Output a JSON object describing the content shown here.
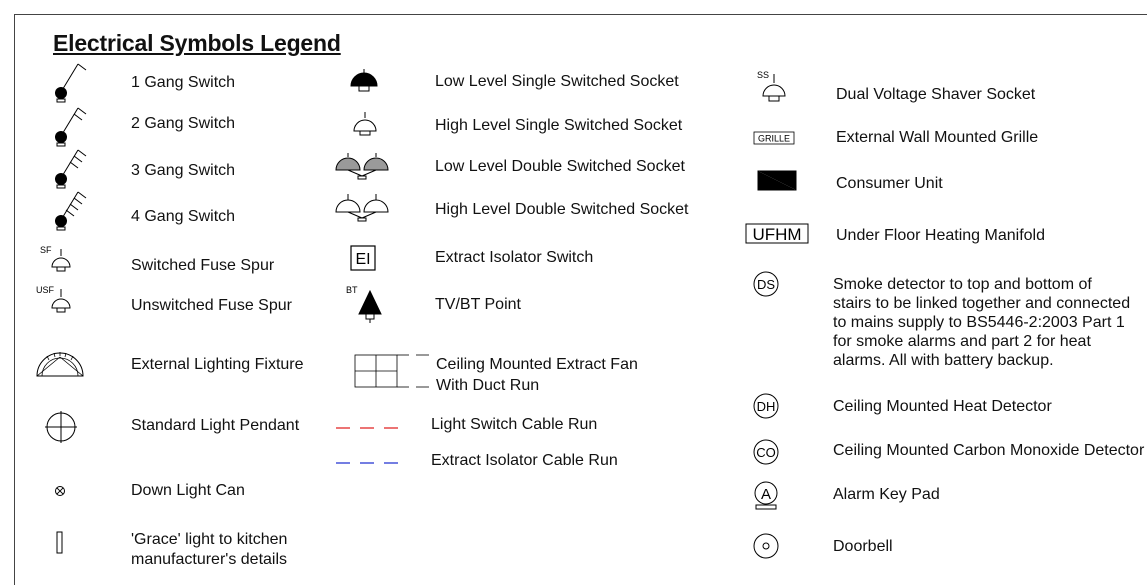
{
  "title": "Electrical Symbols Legend",
  "col1": {
    "one_gang": "1 Gang Switch",
    "two_gang": "2 Gang Switch",
    "three_gang": "3 Gang Switch",
    "four_gang": "4 Gang Switch",
    "switched_fuse": "Switched Fuse Spur",
    "unswitched_fuse": "Unswitched Fuse Spur",
    "ext_lighting": "External Lighting Fixture",
    "std_pendant": "Standard Light Pendant",
    "down_light": "Down Light Can",
    "grace": "'Grace' light to kitchen manufacturer's details"
  },
  "col2": {
    "low_single": "Low Level Single Switched Socket",
    "high_single": "High Level Single Switched Socket",
    "low_double": "Low Level Double Switched Socket",
    "high_double": "High Level Double Switched Socket",
    "extract_isolator": "Extract Isolator Switch",
    "tv_bt": "TV/BT Point",
    "extract_fan_1": "Ceiling Mounted Extract Fan",
    "extract_fan_2": "With Duct Run",
    "light_cable": "Light Switch Cable Run",
    "extract_cable": "Extract Isolator Cable Run"
  },
  "col3": {
    "shaver": "Dual Voltage Shaver Socket",
    "grille": "External Wall Mounted Grille",
    "consumer": "Consumer Unit",
    "ufhm": "Under Floor Heating Manifold",
    "smoke": "Smoke detector to top and bottom of stairs to be linked together and connected to mains supply to BS5446-2:2003 Part 1 for smoke alarms and part 2 for heat alarms. All with battery backup.",
    "heat": "Ceiling Mounted Heat Detector",
    "co": "Ceiling Mounted Carbon Monoxide Detector",
    "alarm": "Alarm Key Pad",
    "doorbell": "Doorbell"
  },
  "symbol_text": {
    "sf": "SF",
    "usf": "USF",
    "ei": "EI",
    "bt": "BT",
    "ss": "SS",
    "grille": "GRILLE",
    "ufhm": "UFHM",
    "ds": "DS",
    "dh": "DH",
    "co": "CO",
    "a": "A"
  },
  "colors": {
    "light_switch_cable": "#e02020",
    "extract_cable": "#2030d0"
  }
}
